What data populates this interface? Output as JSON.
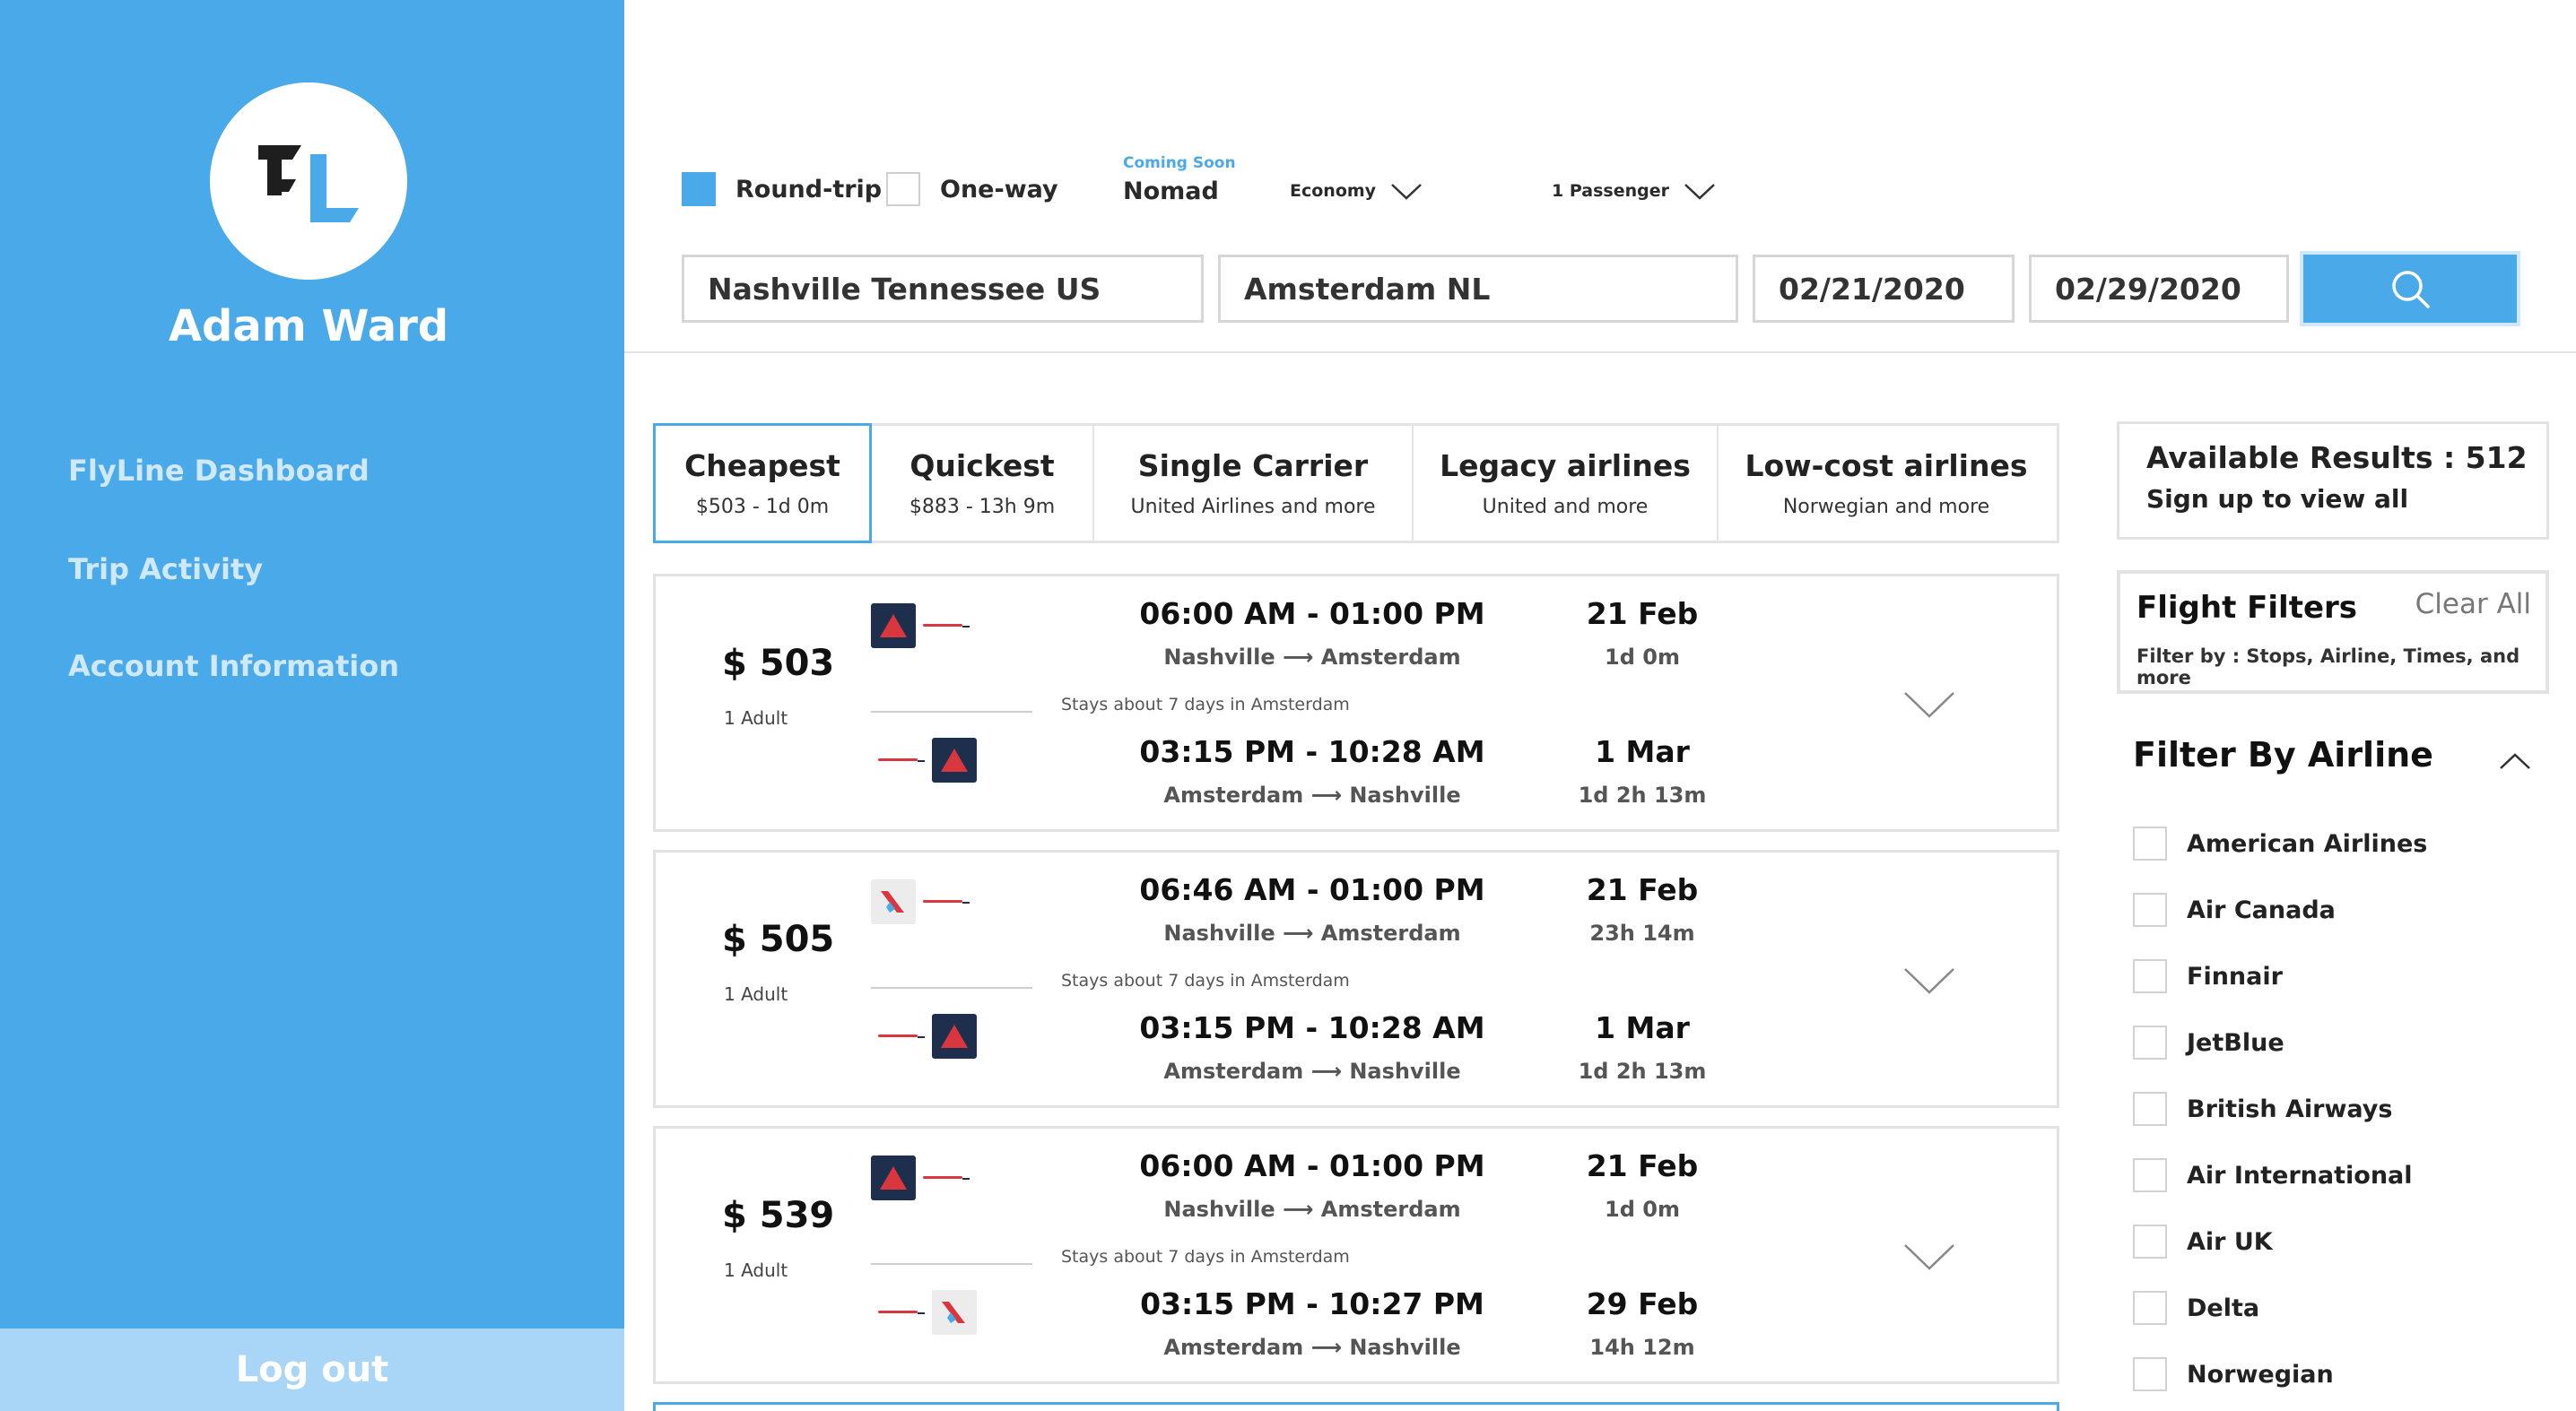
{
  "sidebar": {
    "user_name": "Adam Ward",
    "nav": [
      "FlyLine Dashboard",
      "Trip Activity",
      "Account Information"
    ],
    "logout": "Log out"
  },
  "search": {
    "trip_types": [
      {
        "label": "Round-trip",
        "checked": true
      },
      {
        "label": "One-way",
        "checked": false
      }
    ],
    "coming_soon": "Coming Soon",
    "nomad": "Nomad",
    "cabin": "Economy",
    "passengers": "1 Passenger",
    "origin": "Nashville Tennessee US",
    "destination": "Amsterdam  NL",
    "depart_date": "02/21/2020",
    "return_date": "02/29/2020"
  },
  "tabs": [
    {
      "title": "Cheapest",
      "sub": "$503 - 1d 0m",
      "active": true
    },
    {
      "title": "Quickest",
      "sub": "$883 - 13h 9m",
      "active": false
    },
    {
      "title": "Single Carrier",
      "sub": "United Airlines and more",
      "active": false
    },
    {
      "title": "Legacy airlines",
      "sub": "United and more",
      "active": false
    },
    {
      "title": "Low-cost airlines",
      "sub": "Norwegian and more",
      "active": false
    }
  ],
  "results": [
    {
      "price": "$ 503",
      "pax": "1 Adult",
      "stay": "Stays about 7 days in Amsterdam",
      "out_logo": "delta",
      "ret_logo": "delta",
      "out_time": "06:00 AM - 01:00 PM",
      "out_from": "Nashville",
      "out_to": "Amsterdam",
      "out_date": "21 Feb",
      "out_dur": "1d 0m",
      "ret_time": "03:15 PM - 10:28 AM",
      "ret_from": "Amsterdam",
      "ret_to": "Nashville",
      "ret_date": "1 Mar",
      "ret_dur": "1d 2h 13m"
    },
    {
      "price": "$ 505",
      "pax": "1 Adult",
      "stay": "Stays about 7 days in Amsterdam",
      "out_logo": "aa",
      "ret_logo": "delta",
      "out_time": "06:46 AM - 01:00 PM",
      "out_from": "Nashville",
      "out_to": "Amsterdam",
      "out_date": "21 Feb",
      "out_dur": "23h 14m",
      "ret_time": "03:15 PM - 10:28 AM",
      "ret_from": "Amsterdam",
      "ret_to": "Nashville",
      "ret_date": "1 Mar",
      "ret_dur": "1d 2h 13m"
    },
    {
      "price": "$ 539",
      "pax": "1 Adult",
      "stay": "Stays about 7 days in Amsterdam",
      "out_logo": "delta",
      "ret_logo": "aa",
      "out_time": "06:00 AM - 01:00 PM",
      "out_from": "Nashville",
      "out_to": "Amsterdam",
      "out_date": "21 Feb",
      "out_dur": "1d 0m",
      "ret_time": "03:15 PM - 10:27 PM",
      "ret_from": "Amsterdam",
      "ret_to": "Nashville",
      "ret_date": "29 Feb",
      "ret_dur": "14h 12m"
    }
  ],
  "summary": {
    "available": "Available Results : 512",
    "signup": "Sign up to view all"
  },
  "filters": {
    "title": "Flight Filters",
    "clear": "Clear All",
    "subtitle": "Filter by : Stops, Airline, Times, and more",
    "airline_heading": "Filter By Airline",
    "airlines": [
      "American Airlines",
      "Air Canada",
      "Finnair",
      "JetBlue",
      "British Airways",
      "Air International",
      "Air UK",
      "Delta",
      "Norwegian"
    ]
  },
  "colors": {
    "accent": "#4aa9e9",
    "sidebar_nav": "#cfe8fa",
    "logout_bg": "#a9d6f6",
    "delta_logo_bg": "#1e2e4d",
    "delta_logo_mark": "#d9363e"
  }
}
